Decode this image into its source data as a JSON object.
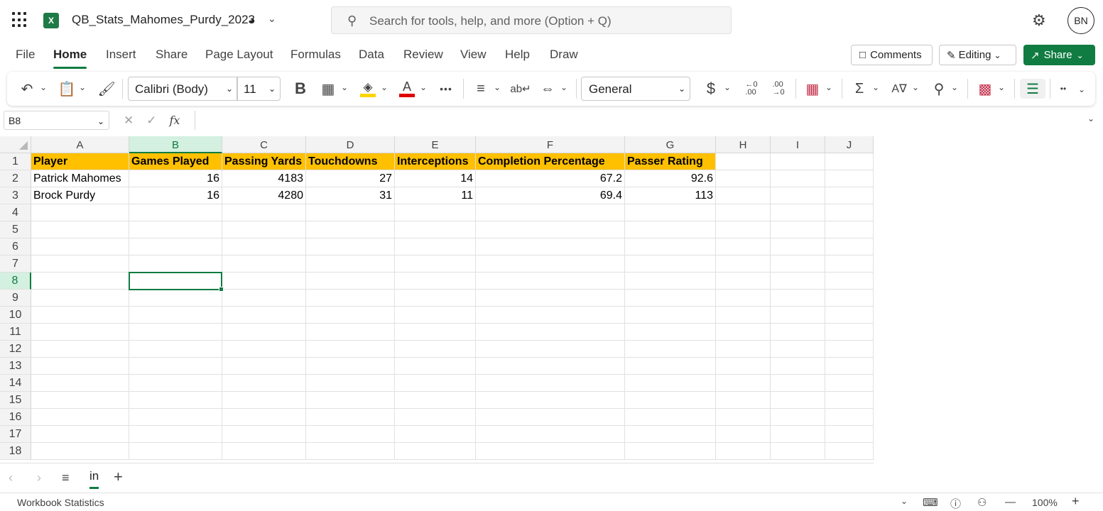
{
  "title_bar": {
    "doc_title": "QB_Stats_Mahomes_Purdy_2023",
    "search_placeholder": "Search for tools, help, and more (Option + Q)",
    "avatar_initials": "BN",
    "app_icon_letter": "X"
  },
  "menu": {
    "tabs": [
      "File",
      "Home",
      "Insert",
      "Share",
      "Page Layout",
      "Formulas",
      "Data",
      "Review",
      "View",
      "Help",
      "Draw"
    ],
    "active_tab": "Home",
    "comments_label": "Comments",
    "editing_label": "Editing",
    "share_label": "Share"
  },
  "ribbon": {
    "font_name": "Calibri (Body)",
    "font_size": "11",
    "bold_label": "B",
    "number_format": "General",
    "currency_symbol": "$",
    "more_label": "•••",
    "overflow_label": "••"
  },
  "formula_bar": {
    "name_box": "B8",
    "fx_label": "fx",
    "formula_value": ""
  },
  "grid": {
    "columns": [
      "A",
      "B",
      "C",
      "D",
      "E",
      "F",
      "G",
      "H",
      "I",
      "J"
    ],
    "selected_column": "B",
    "selected_row": 8,
    "rows": [
      "1",
      "2",
      "3",
      "4",
      "5",
      "6",
      "7",
      "8",
      "9",
      "10",
      "11",
      "12",
      "13",
      "14",
      "15",
      "16",
      "17",
      "18"
    ],
    "header_row": [
      "Player",
      "Games Played",
      "Passing Yards",
      "Touchdowns",
      "Interceptions",
      "Completion Percentage",
      "Passer Rating"
    ],
    "data_rows": [
      [
        "Patrick Mahomes",
        "16",
        "4183",
        "27",
        "14",
        "67.2",
        "92.6"
      ],
      [
        "Brock Purdy",
        "16",
        "4280",
        "31",
        "11",
        "69.4",
        "113"
      ]
    ]
  },
  "sheets": {
    "tabs": [
      "in"
    ],
    "active": "in"
  },
  "status_bar": {
    "text": "Workbook Statistics",
    "zoom": "100%"
  },
  "colors": {
    "accent": "#107c41",
    "header_fill": "#ffc000",
    "font_color_bar": "#e00000",
    "highlight_bar": "#ffd400"
  }
}
